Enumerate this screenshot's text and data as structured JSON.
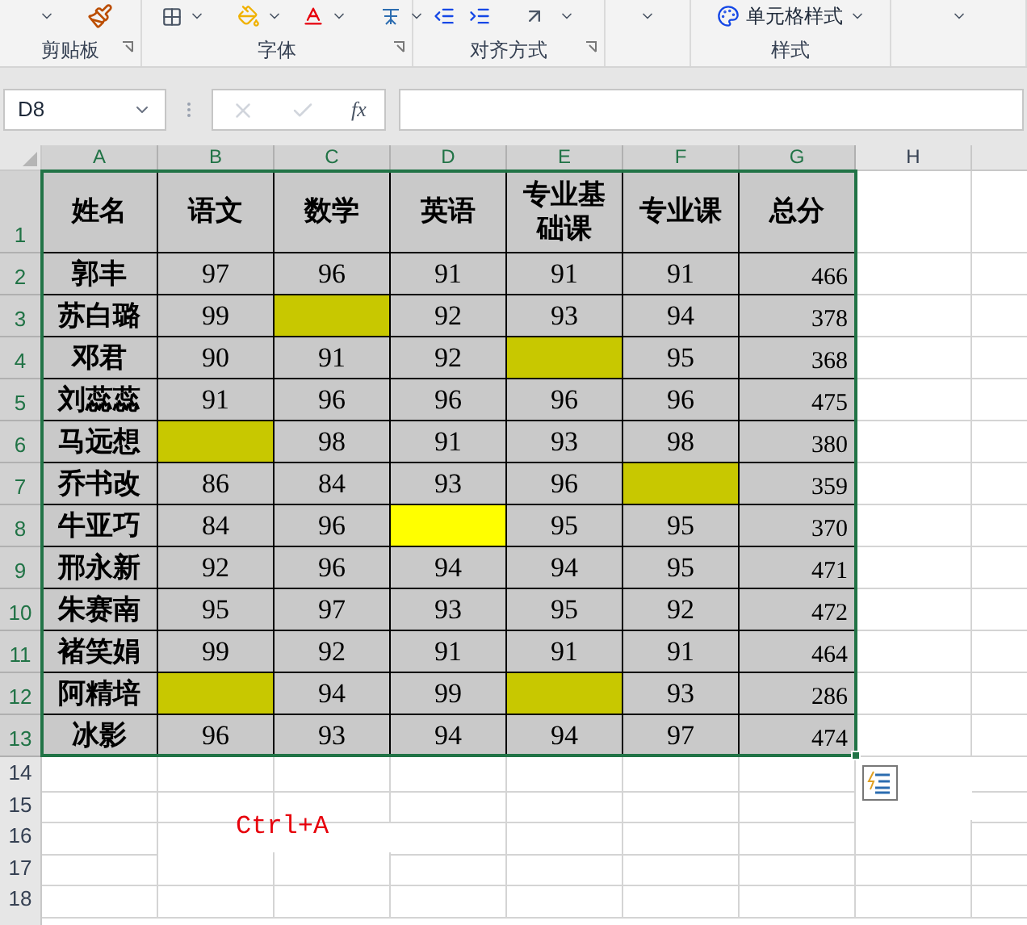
{
  "ribbon": {
    "groups": [
      {
        "label": "剪贴板",
        "dialog_launcher": true
      },
      {
        "label": "字体",
        "dialog_launcher": true
      },
      {
        "label": "对齐方式",
        "dialog_launcher": true
      },
      {
        "dialog_launcher": false
      },
      {
        "label": "样式",
        "dialog_launcher": false,
        "button": "单元格样式"
      },
      {
        "dialog_launcher": false
      }
    ]
  },
  "formula_bar": {
    "name_box": "D8",
    "function_label": "fx"
  },
  "sheet": {
    "columns": [
      "A",
      "B",
      "C",
      "D",
      "E",
      "F",
      "G",
      "H"
    ],
    "row_numbers": [
      "1",
      "2",
      "3",
      "4",
      "5",
      "6",
      "7",
      "8",
      "9",
      "10",
      "11",
      "12",
      "13",
      "14",
      "15",
      "16",
      "17",
      "18"
    ],
    "header": [
      "姓名",
      "语文",
      "数学",
      "英语",
      "专业基础课",
      "专业课",
      "总分"
    ],
    "rows": [
      [
        {
          "text": "郭丰"
        },
        {
          "text": "97"
        },
        {
          "text": "96"
        },
        {
          "text": "91"
        },
        {
          "text": "91"
        },
        {
          "text": "91"
        },
        {
          "text": "466"
        }
      ],
      [
        {
          "text": "苏白璐"
        },
        {
          "text": "99"
        },
        {
          "text": "",
          "color": "#c8c800"
        },
        {
          "text": "92"
        },
        {
          "text": "93"
        },
        {
          "text": "94"
        },
        {
          "text": "378"
        }
      ],
      [
        {
          "text": "邓君"
        },
        {
          "text": "90"
        },
        {
          "text": "91"
        },
        {
          "text": "92"
        },
        {
          "text": "",
          "color": "#c8c800"
        },
        {
          "text": "95"
        },
        {
          "text": "368"
        }
      ],
      [
        {
          "text": "刘蕊蕊"
        },
        {
          "text": "91"
        },
        {
          "text": "96"
        },
        {
          "text": "96"
        },
        {
          "text": "96"
        },
        {
          "text": "96"
        },
        {
          "text": "475"
        }
      ],
      [
        {
          "text": "马远想"
        },
        {
          "text": "",
          "color": "#c8c800"
        },
        {
          "text": "98"
        },
        {
          "text": "91"
        },
        {
          "text": "93"
        },
        {
          "text": "98"
        },
        {
          "text": "380"
        }
      ],
      [
        {
          "text": "乔书改"
        },
        {
          "text": "86"
        },
        {
          "text": "84"
        },
        {
          "text": "93"
        },
        {
          "text": "96"
        },
        {
          "text": "",
          "color": "#c8c800"
        },
        {
          "text": "359"
        }
      ],
      [
        {
          "text": "牛亚巧"
        },
        {
          "text": "84"
        },
        {
          "text": "96"
        },
        {
          "text": "",
          "color": "#ffff00"
        },
        {
          "text": "95"
        },
        {
          "text": "95"
        },
        {
          "text": "370"
        }
      ],
      [
        {
          "text": "邢永新"
        },
        {
          "text": "92"
        },
        {
          "text": "96"
        },
        {
          "text": "94"
        },
        {
          "text": "94"
        },
        {
          "text": "95"
        },
        {
          "text": "471"
        }
      ],
      [
        {
          "text": "朱赛南"
        },
        {
          "text": "95"
        },
        {
          "text": "97"
        },
        {
          "text": "93"
        },
        {
          "text": "95"
        },
        {
          "text": "92"
        },
        {
          "text": "472"
        }
      ],
      [
        {
          "text": "褚笑娟"
        },
        {
          "text": "99"
        },
        {
          "text": "92"
        },
        {
          "text": "91"
        },
        {
          "text": "91"
        },
        {
          "text": "91"
        },
        {
          "text": "464"
        }
      ],
      [
        {
          "text": "阿精培"
        },
        {
          "text": "",
          "color": "#c8c800"
        },
        {
          "text": "94"
        },
        {
          "text": "99"
        },
        {
          "text": "",
          "color": "#c8c800"
        },
        {
          "text": "93"
        },
        {
          "text": "286"
        }
      ],
      [
        {
          "text": "冰影"
        },
        {
          "text": "96"
        },
        {
          "text": "93"
        },
        {
          "text": "94"
        },
        {
          "text": "94"
        },
        {
          "text": "97"
        },
        {
          "text": "474"
        }
      ]
    ],
    "note": "Ctrl+A"
  }
}
